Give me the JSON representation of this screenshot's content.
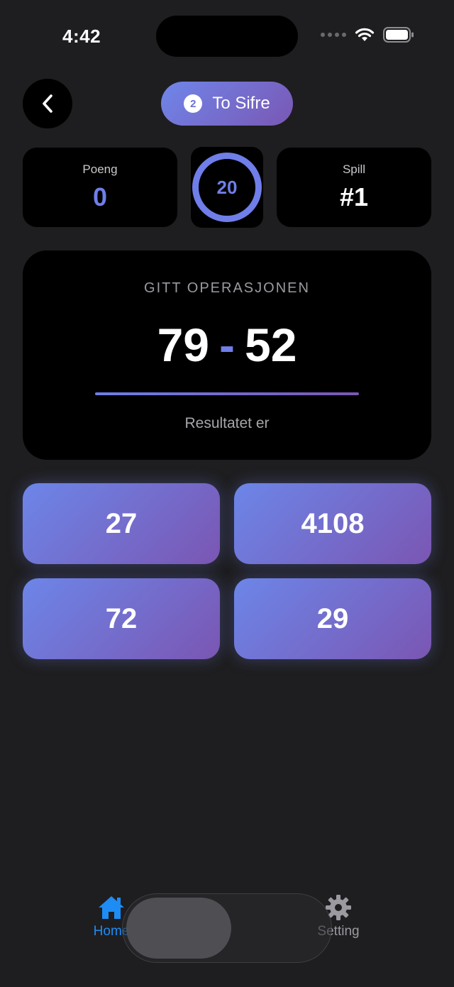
{
  "status_bar": {
    "time": "4:42"
  },
  "header": {
    "level_number": "2",
    "level_label": "To Sifre"
  },
  "stats": {
    "score_label": "Poeng",
    "score_value": "0",
    "timer_value": "20",
    "game_label": "Spill",
    "game_value": "#1"
  },
  "question": {
    "caption": "GITT OPERASJONEN",
    "left_operand": "79",
    "operator": "-",
    "right_operand": "52",
    "result_caption": "Resultatet er"
  },
  "answers": [
    "27",
    "4108",
    "72",
    "29"
  ],
  "tab_bar": {
    "home_label": "Home",
    "setting_label": "Setting"
  },
  "colors": {
    "background": "#1e1e20",
    "accent": "#6f7ee8",
    "gradient_end": "#7a57b4",
    "tab_active": "#1e8cf5"
  }
}
